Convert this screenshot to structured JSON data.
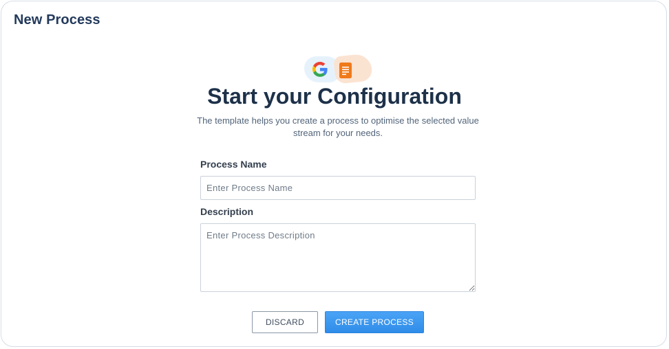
{
  "header": {
    "title": "New Process"
  },
  "hero": {
    "icons": [
      "google-g-icon",
      "document-icon"
    ],
    "heading": "Start your Configuration",
    "subtitle": "The template helps you create a process to optimise the selected value stream for your needs."
  },
  "form": {
    "process_name": {
      "label": "Process Name",
      "value": "",
      "placeholder": "Enter Process Name"
    },
    "description": {
      "label": "Description",
      "value": "",
      "placeholder": "Enter Process Description"
    }
  },
  "actions": {
    "discard_label": "DISCARD",
    "create_label": "CREATE PROCESS"
  },
  "colors": {
    "title": "#233a5c",
    "primary_button": "#3a95ec",
    "google_blue": "#4285f4",
    "doc_orange": "#f07a1a"
  }
}
